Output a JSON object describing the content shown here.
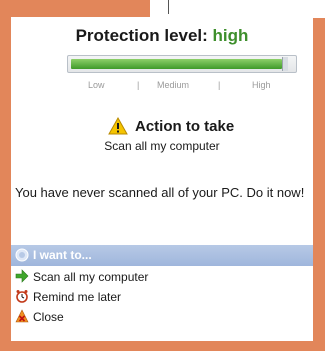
{
  "header": {
    "title_prefix": "Protection level: ",
    "level": "high"
  },
  "meter": {
    "level_fraction": 0.96,
    "scale_labels": [
      "Low",
      "|",
      "Medium",
      "|",
      "High"
    ]
  },
  "action": {
    "title": "Action to take",
    "subtitle": "Scan all my computer"
  },
  "message": "You have never scanned all of your PC. Do it now!",
  "menu": {
    "header": "I want to...",
    "items": [
      {
        "label": "Scan all my computer",
        "icon": "green-arrow-icon"
      },
      {
        "label": "Remind me later",
        "icon": "alarm-clock-icon"
      },
      {
        "label": "Close",
        "icon": "close-icon"
      }
    ]
  },
  "colors": {
    "frame": "#e2865a",
    "level_text": "#3e8f2c",
    "menu_header": "#a8bde0"
  }
}
